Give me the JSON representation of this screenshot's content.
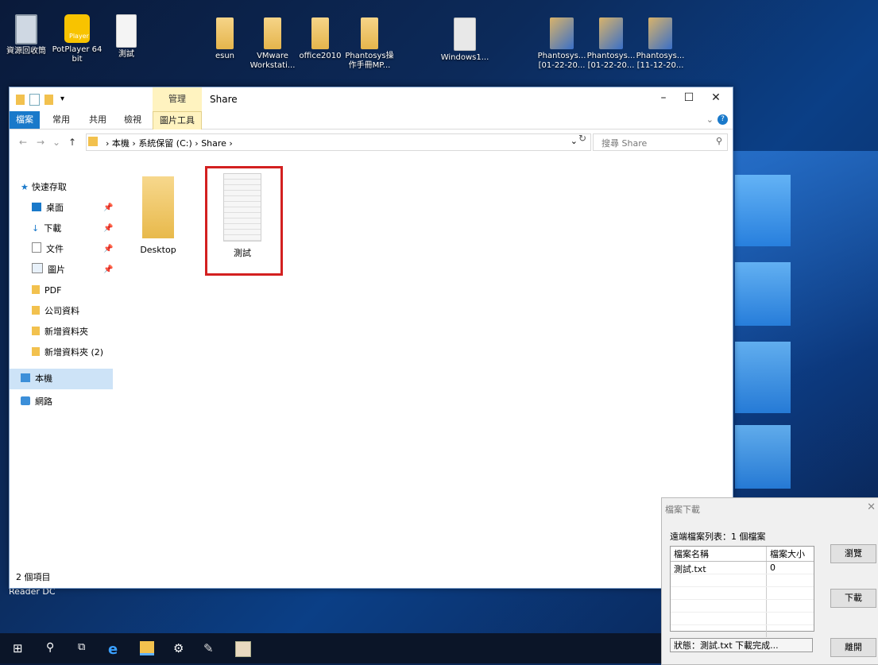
{
  "desktop": {
    "icons": [
      {
        "name": "recycle-bin-icon",
        "label": "資源回收筒"
      },
      {
        "name": "potplayer-icon",
        "label": "PotPlayer 64 bit"
      },
      {
        "name": "test-doc-icon",
        "label": "測試"
      },
      {
        "name": "esun-folder-icon",
        "label": "esun"
      },
      {
        "name": "vmware-folder-icon",
        "label": "VMware Workstati..."
      },
      {
        "name": "office2010-folder-icon",
        "label": "office2010"
      },
      {
        "name": "phantosys-manual-folder-icon",
        "label": "Phantosys操作手冊MP..."
      },
      {
        "name": "windows-disc-icon",
        "label": "Windows1..."
      },
      {
        "name": "phantosys-setup-icon-1",
        "label": "Phantosys... [01-22-20..."
      },
      {
        "name": "phantosys-setup-icon-2",
        "label": "Phantosys... [01-22-20..."
      },
      {
        "name": "phantosys-setup-icon-3",
        "label": "Phantosys... [11-12-20..."
      }
    ],
    "behind_window_text": "Reader DC",
    "player_badge": "Player"
  },
  "explorer": {
    "title": "Share",
    "context_tab_header": "管理",
    "ribbon_tabs": [
      "檔案",
      "常用",
      "共用",
      "檢視",
      "圖片工具"
    ],
    "breadcrumbs": [
      "本機",
      "系統保留 (C:)",
      "Share"
    ],
    "search_placeholder": "搜尋 Share",
    "nav": {
      "quick_access": "快速存取",
      "items": [
        "桌面",
        "下載",
        "文件",
        "圖片",
        "PDF",
        "公司資料",
        "新增資料夾",
        "新增資料夾 (2)"
      ],
      "this_pc": "本機",
      "network": "網路"
    },
    "files": [
      {
        "name": "Desktop",
        "type": "folder"
      },
      {
        "name": "測試",
        "type": "text"
      }
    ],
    "status": "2 個項目"
  },
  "dialog": {
    "title": "檔案下載",
    "info": "遠端檔案列表：1 個檔案",
    "columns": [
      "檔案名稱",
      "檔案大小"
    ],
    "rows": [
      {
        "name": "測試.txt",
        "size": "0"
      }
    ],
    "buttons": {
      "browse": "瀏覽",
      "download": "下載",
      "close": "離開"
    },
    "status": "狀態：測試.txt 下載完成..."
  }
}
